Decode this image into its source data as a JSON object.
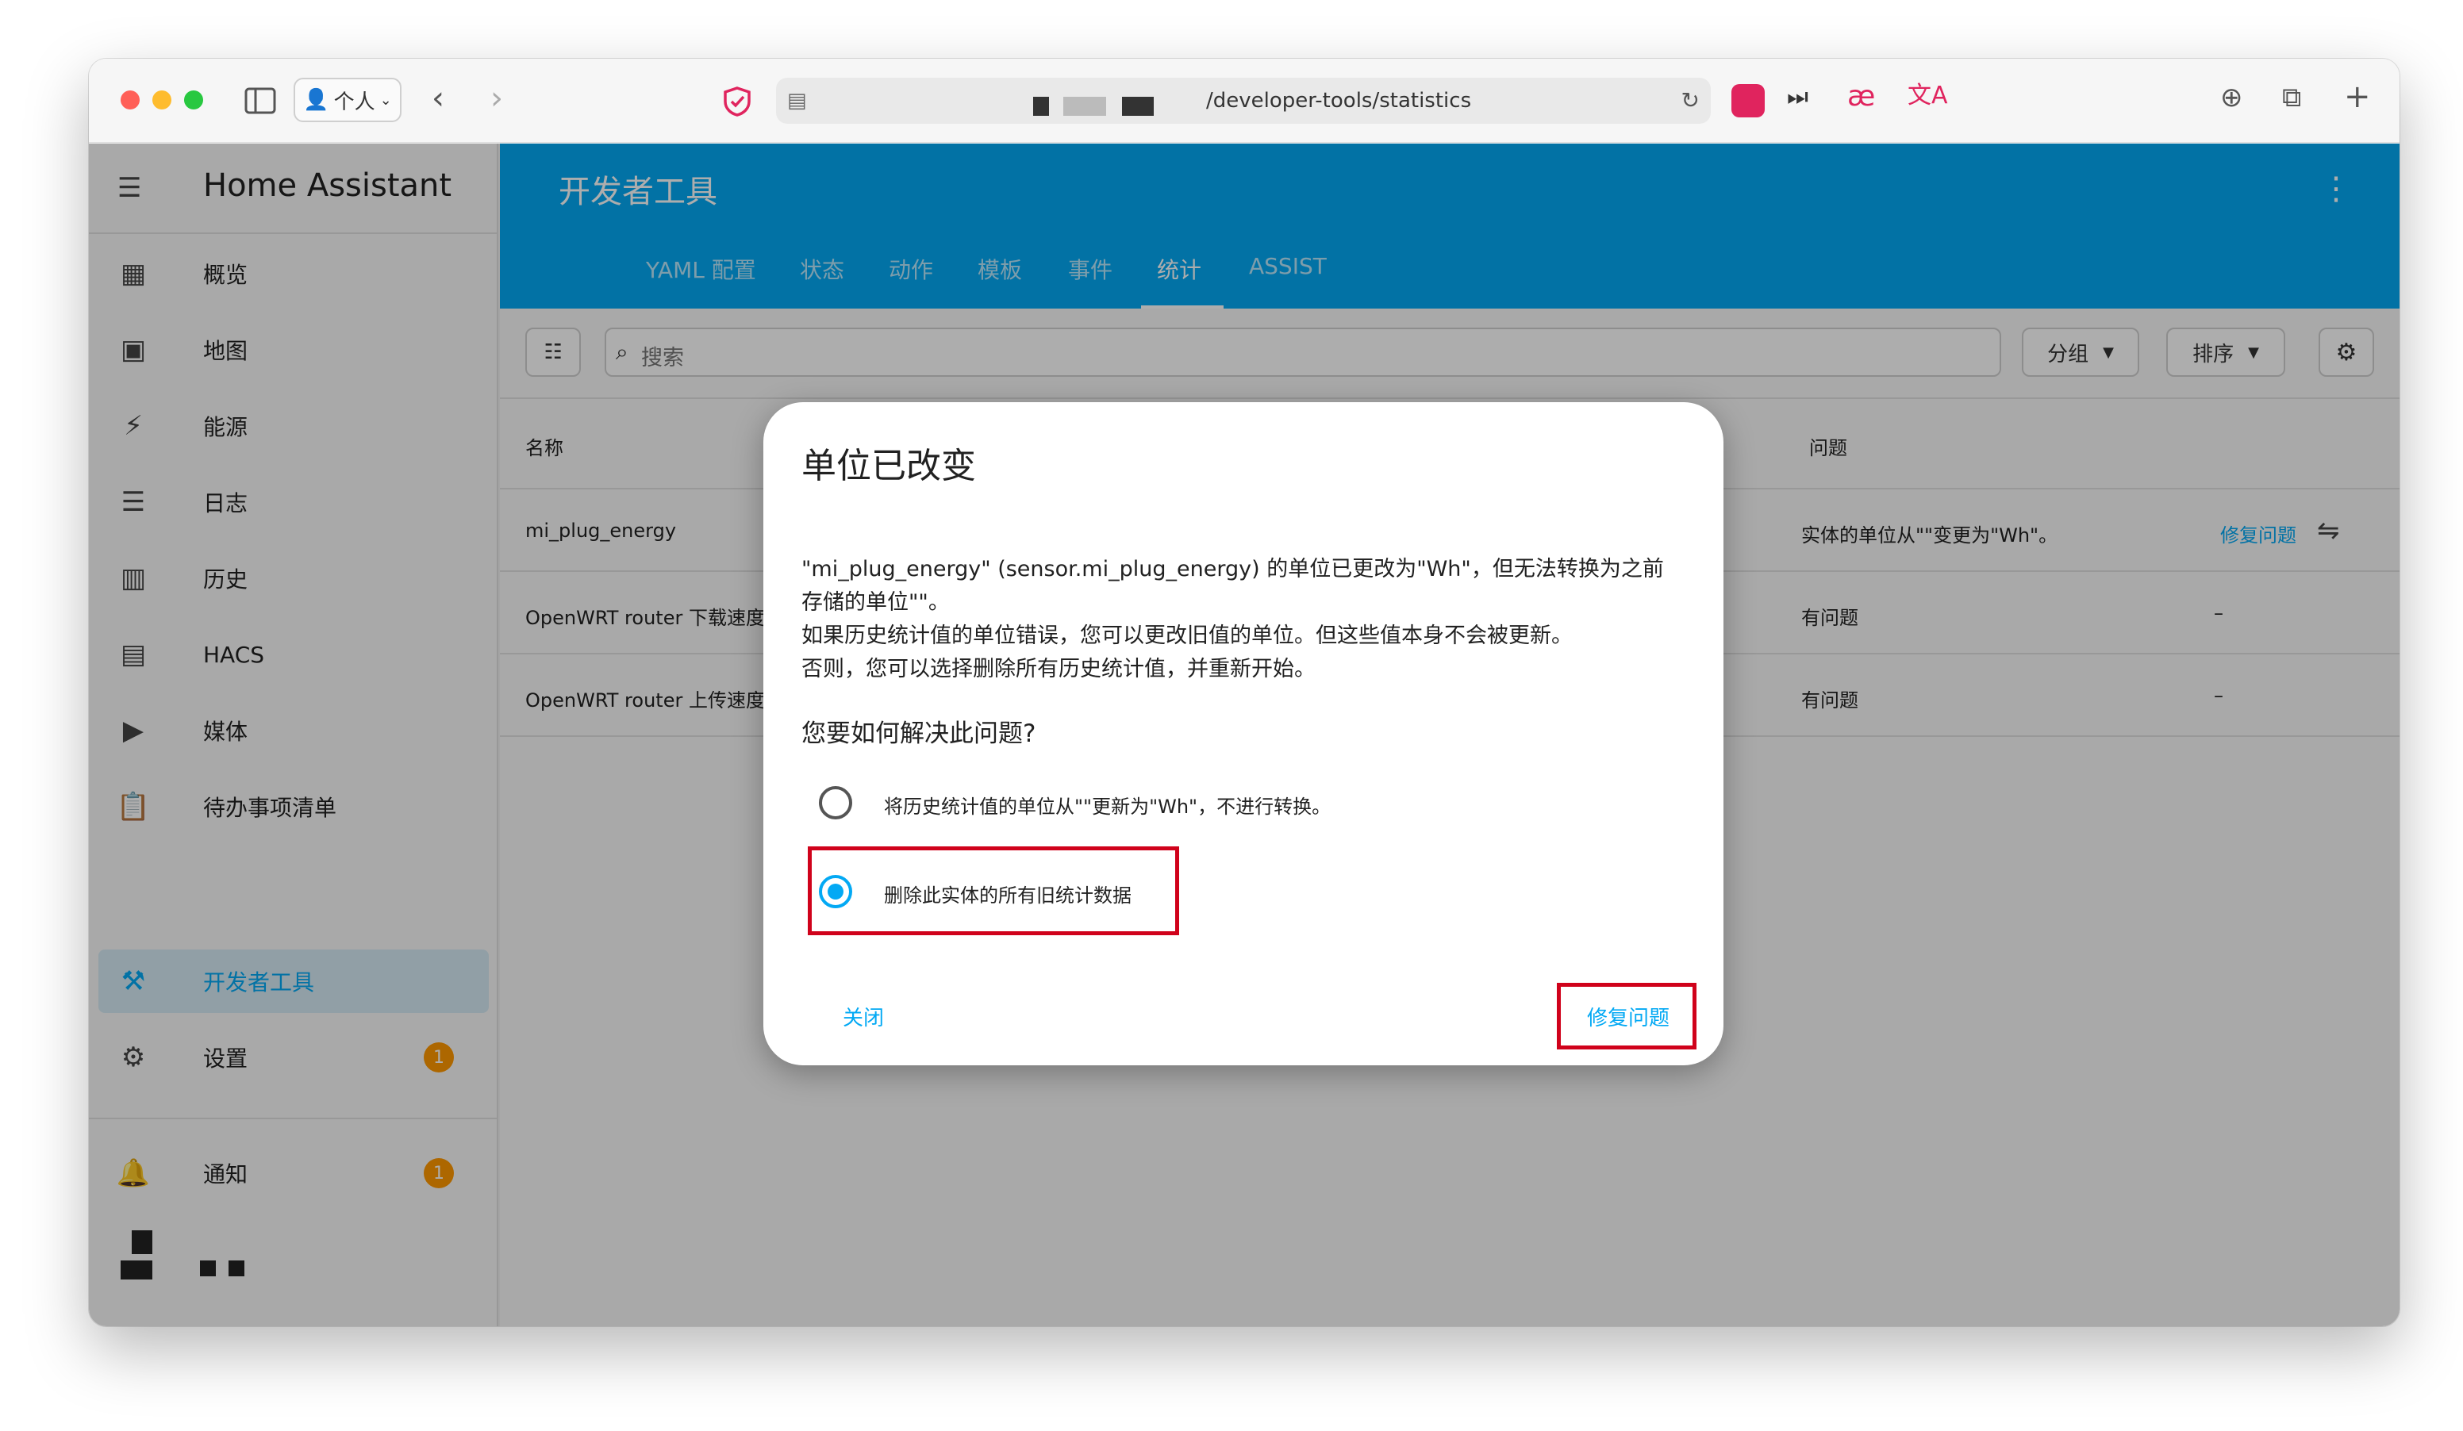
{
  "browser": {
    "profile_label": "个人",
    "url": "/developer-tools/statistics"
  },
  "sidebar": {
    "app_title": "Home Assistant",
    "items": [
      {
        "label": "概览",
        "icon": "dashboard-icon"
      },
      {
        "label": "地图",
        "icon": "map-icon"
      },
      {
        "label": "能源",
        "icon": "lightning-icon"
      },
      {
        "label": "日志",
        "icon": "list-icon"
      },
      {
        "label": "历史",
        "icon": "chart-icon"
      },
      {
        "label": "HACS",
        "icon": "hacs-icon"
      },
      {
        "label": "媒体",
        "icon": "media-icon"
      },
      {
        "label": "待办事项清单",
        "icon": "clipboard-icon"
      }
    ],
    "developer_tools": "开发者工具",
    "settings": "设置",
    "settings_badge": "1",
    "notifications": "通知",
    "notifications_badge": "1"
  },
  "header": {
    "title": "开发者工具",
    "tabs": [
      "YAML 配置",
      "状态",
      "动作",
      "模板",
      "事件",
      "统计",
      "ASSIST"
    ],
    "active_tab": "统计"
  },
  "filters": {
    "search_placeholder": "搜索",
    "group_label": "分组",
    "sort_label": "排序"
  },
  "table": {
    "col_name": "名称",
    "col_issue": "问题",
    "rows": [
      {
        "name": "mi_plug_energy",
        "issue": "实体的单位从\"\"变更为\"Wh\"。",
        "action": "修复问题"
      },
      {
        "name": "OpenWRT router 下载速度",
        "issue": "有问题",
        "action": "–"
      },
      {
        "name": "OpenWRT router 上传速度",
        "issue": "有问题",
        "action": "–"
      }
    ]
  },
  "dialog": {
    "title": "单位已改变",
    "line1": "\"mi_plug_energy\" (sensor.mi_plug_energy) 的单位已更改为\"Wh\"，但无法转换为之前",
    "line2": "存储的单位\"\"。",
    "line3": "如果历史统计值的单位错误，您可以更改旧值的单位。但这些值本身不会被更新。",
    "line4": "否则，您可以选择删除所有历史统计值，并重新开始。",
    "question": "您要如何解决此问题?",
    "option1": "将历史统计值的单位从\"\"更新为\"Wh\"，不进行转换。",
    "option2": "删除此实体的所有旧统计数据",
    "close": "关闭",
    "fix": "修复问题"
  },
  "colors": {
    "primary": "#03a9f4",
    "highlight": "#d0021b",
    "badge": "#ff9800"
  }
}
